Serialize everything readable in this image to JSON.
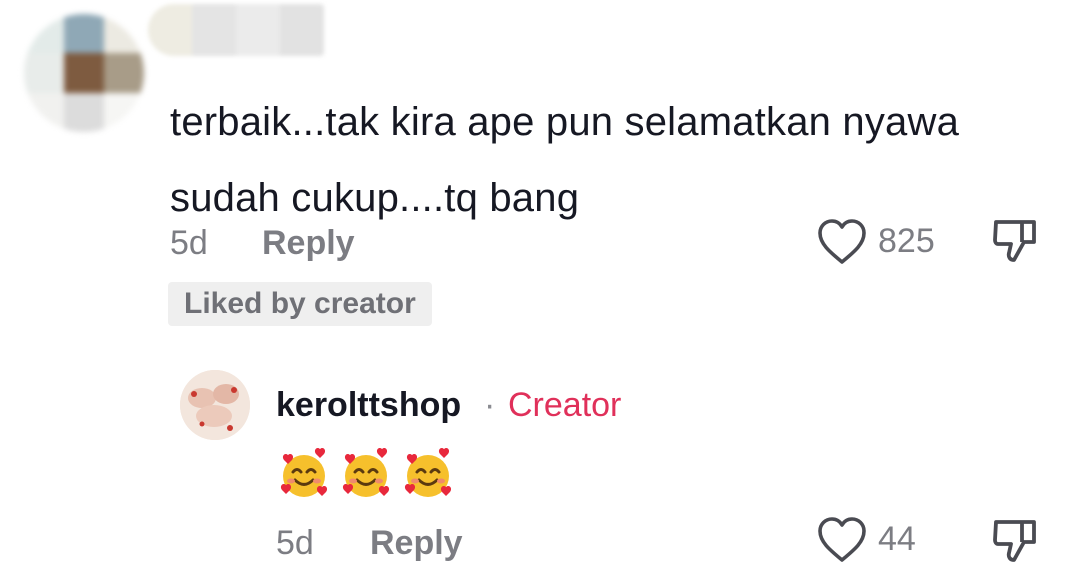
{
  "comment": {
    "text": "terbaik...tak kira ape pun selamatkan nyawa sudah cukup....tq bang",
    "time": "5d",
    "reply_label": "Reply",
    "like_count": "825",
    "liked_badge": "Liked by creator"
  },
  "reply": {
    "username": "kerolttshop",
    "separator": "·",
    "creator_label": "Creator",
    "time": "5d",
    "reply_label": "Reply",
    "like_count": "44",
    "emoji_icons": [
      "smiling-face-with-hearts-icon",
      "smiling-face-with-hearts-icon",
      "smiling-face-with-hearts-icon"
    ]
  },
  "colors": {
    "text_primary": "#161823",
    "text_secondary": "#7c7d83",
    "creator_accent": "#e0305a",
    "badge_bg": "#efefef"
  }
}
